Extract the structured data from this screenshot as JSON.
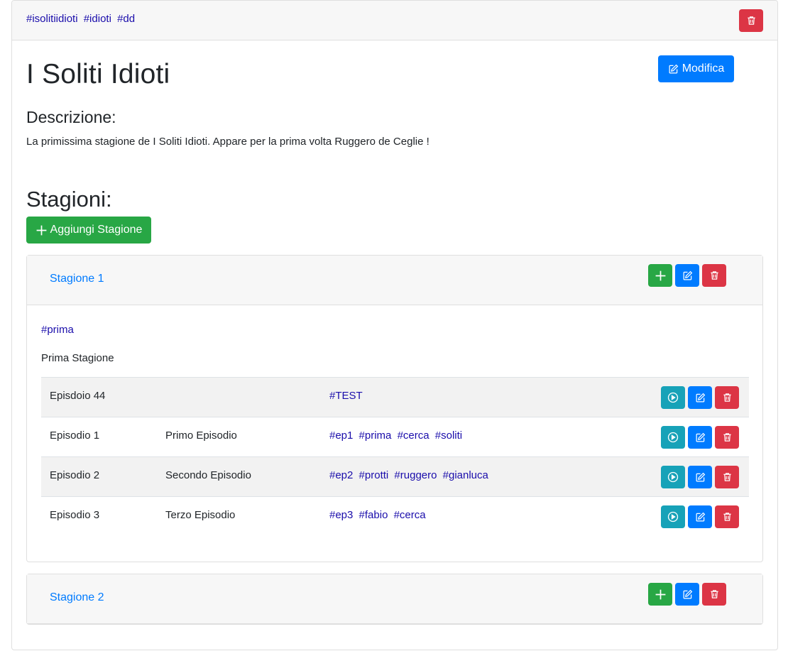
{
  "series": {
    "tags": [
      "#isolitiidioti",
      "#idioti",
      "#dd"
    ],
    "title": "I Soliti Idioti",
    "edit_label": "Modifica",
    "description_heading": "Descrizione:",
    "description": "La primissima stagione de I Soliti Idioti. Appare per la prima volta Ruggero de Ceglie !"
  },
  "seasons_heading": "Stagioni:",
  "add_season_label": "Aggiungi Stagione",
  "seasons": [
    {
      "title": "Stagione 1",
      "tags": [
        "#prima"
      ],
      "description": "Prima Stagione",
      "episodes": [
        {
          "name": "Episdoio 44",
          "description": "",
          "tags": [
            "#TEST"
          ]
        },
        {
          "name": "Episodio 1",
          "description": "Primo Episodio",
          "tags": [
            "#ep1",
            "#prima",
            "#cerca",
            "#soliti"
          ]
        },
        {
          "name": "Episodio 2",
          "description": "Secondo Episodio",
          "tags": [
            "#ep2",
            "#protti",
            "#ruggero",
            "#gianluca"
          ]
        },
        {
          "name": "Episodio 3",
          "description": "Terzo Episodio",
          "tags": [
            "#ep3",
            "#fabio",
            "#cerca"
          ]
        }
      ]
    },
    {
      "title": "Stagione 2"
    }
  ],
  "colors": {
    "danger": "#dc3545",
    "success": "#28a745",
    "primary": "#007bff",
    "info": "#17a2b8",
    "tag_link": "#1a0dab"
  },
  "icons": {
    "delete": "trash-icon",
    "edit": "edit-icon",
    "add": "plus-icon",
    "play": "play-icon"
  }
}
